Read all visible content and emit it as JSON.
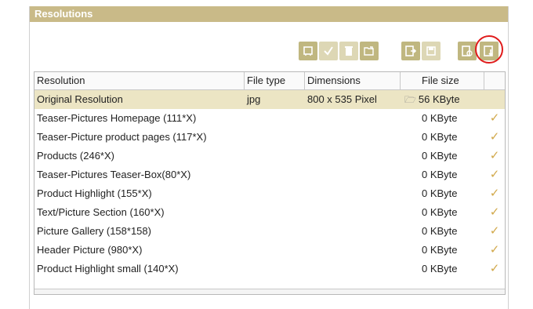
{
  "panel": {
    "title": "Resolutions"
  },
  "toolbar": {
    "buttons": [
      {
        "name": "frame-icon",
        "state": "enabled"
      },
      {
        "name": "checkmark-icon",
        "state": "disabled"
      },
      {
        "name": "trash-icon",
        "state": "disabled"
      },
      {
        "name": "open-folder-icon",
        "state": "enabled"
      },
      {
        "name": "export-icon",
        "state": "enabled"
      },
      {
        "name": "save-icon",
        "state": "disabled"
      },
      {
        "name": "preview-icon",
        "state": "enabled"
      },
      {
        "name": "download-icon",
        "state": "enabled",
        "highlighted": true
      }
    ],
    "accent_color": "#c0b780",
    "highlight_color": "#e01b1b"
  },
  "grid": {
    "headers": {
      "resolution": "Resolution",
      "file_type": "File type",
      "dimensions": "Dimensions",
      "file_size": "File size"
    },
    "rows": [
      {
        "resolution": "Original Resolution",
        "file_type": "jpg",
        "dimensions": "800 x 535 Pixel",
        "file_size": "56 KByte",
        "check": "",
        "folder": "🗁",
        "selected": true
      },
      {
        "resolution": "Teaser-Pictures Homepage (111*X)",
        "file_type": "",
        "dimensions": "",
        "file_size": "0 KByte",
        "check": "✓"
      },
      {
        "resolution": "Teaser-Picture product pages (117*X)",
        "file_type": "",
        "dimensions": "",
        "file_size": "0 KByte",
        "check": "✓"
      },
      {
        "resolution": "Products (246*X)",
        "file_type": "",
        "dimensions": "",
        "file_size": "0 KByte",
        "check": "✓"
      },
      {
        "resolution": "Teaser-Pictures Teaser-Box(80*X)",
        "file_type": "",
        "dimensions": "",
        "file_size": "0 KByte",
        "check": "✓"
      },
      {
        "resolution": "Product Highlight (155*X)",
        "file_type": "",
        "dimensions": "",
        "file_size": "0 KByte",
        "check": "✓"
      },
      {
        "resolution": "Text/Picture Section (160*X)",
        "file_type": "",
        "dimensions": "",
        "file_size": "0 KByte",
        "check": "✓"
      },
      {
        "resolution": "Picture Gallery (158*158)",
        "file_type": "",
        "dimensions": "",
        "file_size": "0 KByte",
        "check": "✓"
      },
      {
        "resolution": "Header Picture (980*X)",
        "file_type": "",
        "dimensions": "",
        "file_size": "0 KByte",
        "check": "✓"
      },
      {
        "resolution": "Product Highlight small (140*X)",
        "file_type": "",
        "dimensions": "",
        "file_size": "0 KByte",
        "check": "✓"
      }
    ],
    "selected_row_color": "#ece5c4",
    "check_color": "#d1a84a"
  }
}
